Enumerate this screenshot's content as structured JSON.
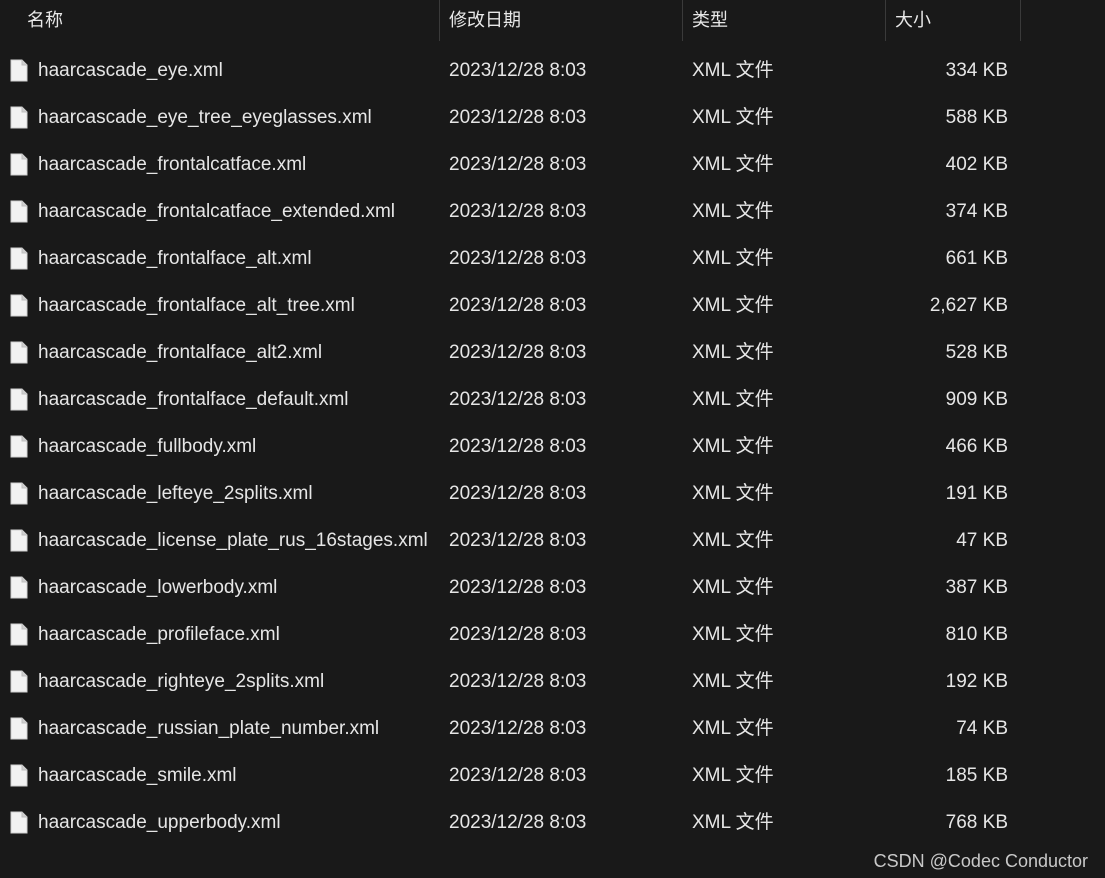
{
  "header": {
    "name_label": "名称",
    "date_label": "修改日期",
    "type_label": "类型",
    "size_label": "大小",
    "sort_indicator": "^"
  },
  "files": [
    {
      "name": "haarcascade_eye.xml",
      "date": "2023/12/28 8:03",
      "type": "XML 文件",
      "size": "334 KB",
      "icon": "file-icon"
    },
    {
      "name": "haarcascade_eye_tree_eyeglasses.xml",
      "date": "2023/12/28 8:03",
      "type": "XML 文件",
      "size": "588 KB",
      "icon": "file-icon"
    },
    {
      "name": "haarcascade_frontalcatface.xml",
      "date": "2023/12/28 8:03",
      "type": "XML 文件",
      "size": "402 KB",
      "icon": "file-icon"
    },
    {
      "name": "haarcascade_frontalcatface_extended.xml",
      "date": "2023/12/28 8:03",
      "type": "XML 文件",
      "size": "374 KB",
      "icon": "file-icon"
    },
    {
      "name": "haarcascade_frontalface_alt.xml",
      "date": "2023/12/28 8:03",
      "type": "XML 文件",
      "size": "661 KB",
      "icon": "file-icon"
    },
    {
      "name": "haarcascade_frontalface_alt_tree.xml",
      "date": "2023/12/28 8:03",
      "type": "XML 文件",
      "size": "2,627 KB",
      "icon": "file-icon"
    },
    {
      "name": "haarcascade_frontalface_alt2.xml",
      "date": "2023/12/28 8:03",
      "type": "XML 文件",
      "size": "528 KB",
      "icon": "file-icon"
    },
    {
      "name": "haarcascade_frontalface_default.xml",
      "date": "2023/12/28 8:03",
      "type": "XML 文件",
      "size": "909 KB",
      "icon": "file-icon"
    },
    {
      "name": "haarcascade_fullbody.xml",
      "date": "2023/12/28 8:03",
      "type": "XML 文件",
      "size": "466 KB",
      "icon": "file-icon"
    },
    {
      "name": "haarcascade_lefteye_2splits.xml",
      "date": "2023/12/28 8:03",
      "type": "XML 文件",
      "size": "191 KB",
      "icon": "file-icon"
    },
    {
      "name": "haarcascade_license_plate_rus_16stages.xml",
      "date": "2023/12/28 8:03",
      "type": "XML 文件",
      "size": "47 KB",
      "icon": "file-icon"
    },
    {
      "name": "haarcascade_lowerbody.xml",
      "date": "2023/12/28 8:03",
      "type": "XML 文件",
      "size": "387 KB",
      "icon": "file-icon"
    },
    {
      "name": "haarcascade_profileface.xml",
      "date": "2023/12/28 8:03",
      "type": "XML 文件",
      "size": "810 KB",
      "icon": "file-icon"
    },
    {
      "name": "haarcascade_righteye_2splits.xml",
      "date": "2023/12/28 8:03",
      "type": "XML 文件",
      "size": "192 KB",
      "icon": "file-icon"
    },
    {
      "name": "haarcascade_russian_plate_number.xml",
      "date": "2023/12/28 8:03",
      "type": "XML 文件",
      "size": "74 KB",
      "icon": "file-icon"
    },
    {
      "name": "haarcascade_smile.xml",
      "date": "2023/12/28 8:03",
      "type": "XML 文件",
      "size": "185 KB",
      "icon": "file-icon"
    },
    {
      "name": "haarcascade_upperbody.xml",
      "date": "2023/12/28 8:03",
      "type": "XML 文件",
      "size": "768 KB",
      "icon": "file-icon"
    }
  ],
  "watermark": "CSDN @Codec Conductor",
  "colors": {
    "background": "#191919",
    "text": "#e6e6e6",
    "separator": "#3a3a3a"
  }
}
